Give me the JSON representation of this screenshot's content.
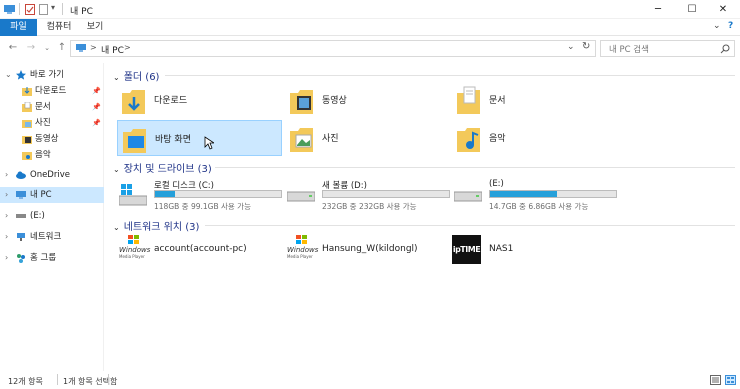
{
  "window": {
    "title": "내 PC"
  },
  "ribbon": {
    "tabs": [
      {
        "label": "파일"
      },
      {
        "label": "컴퓨터"
      },
      {
        "label": "보기"
      }
    ]
  },
  "address": {
    "path_label": "내 PC",
    "sep": ">"
  },
  "search": {
    "placeholder": "내 PC 검색"
  },
  "sidebar": {
    "items": [
      {
        "label": "바로 가기"
      },
      {
        "label": "다운로드"
      },
      {
        "label": "문서"
      },
      {
        "label": "사진"
      },
      {
        "label": "동영상"
      },
      {
        "label": "음악"
      },
      {
        "label": "OneDrive"
      },
      {
        "label": "내 PC"
      },
      {
        "label": "(E:)"
      },
      {
        "label": "네트워크"
      },
      {
        "label": "홈 그룹"
      }
    ]
  },
  "folders": {
    "header": "폴더",
    "count": "(6)",
    "items": [
      {
        "label": "다운로드"
      },
      {
        "label": "동영상"
      },
      {
        "label": "문서"
      },
      {
        "label": "바탕 화면"
      },
      {
        "label": "사진"
      },
      {
        "label": "음악"
      }
    ]
  },
  "drives": {
    "header": "장치 및 드라이브",
    "count": "(3)",
    "items": [
      {
        "name": "로컬 디스크 (C:)",
        "space": "118GB 중 99.1GB 사용 가능",
        "used_fraction": 0.16
      },
      {
        "name": "새 볼륨 (D:)",
        "space": "232GB 중 232GB 사용 가능",
        "used_fraction": 0.0
      },
      {
        "name": "(E:)",
        "space": "14.7GB 중 6.86GB 사용 가능",
        "used_fraction": 0.53
      }
    ]
  },
  "network": {
    "header": "네트워크 위치",
    "count": "(3)",
    "items": [
      {
        "label": "account(account-pc)",
        "icon_text": "Windows",
        "icon_sub": "Media Player"
      },
      {
        "label": "Hansung_W(kildongl)",
        "icon_text": "Windows",
        "icon_sub": "Media Player"
      },
      {
        "label": "NAS1",
        "icon_text": "ipTIME"
      }
    ]
  },
  "status": {
    "item_count": "12개 항목",
    "selected": "1개 항목 선택함"
  },
  "colors": {
    "accent": "#1979ca",
    "selection": "#cce8ff",
    "drive_fill": "#26a0da",
    "group_header": "#1e3287"
  }
}
